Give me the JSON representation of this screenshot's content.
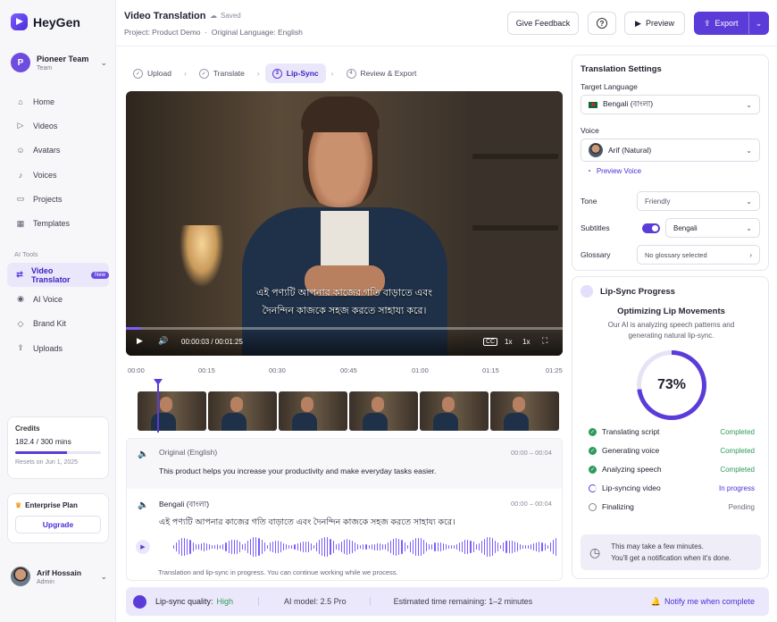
{
  "app": {
    "name": "HeyGen"
  },
  "sidebar": {
    "team": {
      "initial": "P",
      "name": "Pioneer Team",
      "role": "Team"
    },
    "nav": [
      {
        "label": "Home",
        "icon": "home-icon"
      },
      {
        "label": "Videos",
        "icon": "video-icon"
      },
      {
        "label": "Avatars",
        "icon": "avatar-icon"
      },
      {
        "label": "Voices",
        "icon": "voice-icon"
      },
      {
        "label": "Projects",
        "icon": "folder-icon"
      },
      {
        "label": "Templates",
        "icon": "template-icon"
      }
    ],
    "ai_tools_label": "AI Tools",
    "ai_nav": [
      {
        "label": "Video Translator",
        "icon": "translate-icon",
        "badge": "New",
        "active": true
      },
      {
        "label": "AI Voice",
        "icon": "mic-icon"
      },
      {
        "label": "Brand Kit",
        "icon": "brand-icon"
      },
      {
        "label": "Uploads",
        "icon": "upload-icon"
      }
    ],
    "credits": {
      "title": "Credits",
      "value": "182.4 / 300 mins",
      "fraction": 0.608,
      "reset": "Resets on Jun 1, 2025"
    },
    "plan": {
      "title": "Enterprise Plan",
      "button": "Upgrade"
    },
    "user": {
      "name": "Arif Hossain",
      "role": "Admin"
    }
  },
  "header": {
    "title": "Video Translation",
    "saved": "Saved",
    "project": "Project: Product Demo",
    "original_language": "Original Language: English",
    "feedback": "Give Feedback",
    "help": "?",
    "preview": "Preview",
    "export": "Export"
  },
  "steps": [
    {
      "label": "Upload",
      "num": "✓"
    },
    {
      "label": "Translate",
      "num": "✓"
    },
    {
      "label": "Lip-Sync",
      "num": "3"
    },
    {
      "label": "Review & Export",
      "num": "4"
    }
  ],
  "video": {
    "subtitle_line1": "এই পণ্যটি আপনার কাজের গতি বাড়াতে এবং",
    "subtitle_line2": "দৈনন্দিন কাজকে সহজ করতে সাহায্য করে।",
    "time": "00:00:03 / 00:01:25",
    "progress": 0.035,
    "cc": "CC",
    "speed": "1x",
    "zoom": "1x"
  },
  "timeline": {
    "ticks": [
      "00:00",
      "00:15",
      "00:30",
      "00:45",
      "01:00",
      "01:15",
      "01:25"
    ]
  },
  "tracks": {
    "original": {
      "label": "Original (English)",
      "time": "00:00 – 00:04",
      "text": "This product helps you increase your productivity and make everyday tasks easier."
    },
    "translated": {
      "label": "Bengali (বাংলা)",
      "time": "00:00 – 00:04",
      "text": "এই পণ্যটি আপনার কাজের গতি বাড়াতে এবং দৈনন্দিন কাজকে সহজ করতে সাহায্য করে।"
    },
    "note": "Translation and lip-sync in progress. You can continue working while we process."
  },
  "settings": {
    "title": "Translation Settings",
    "target_label": "Target Language",
    "target_value": "Bengali (বাংলা)",
    "voice_label": "Voice",
    "voice_value": "Arif (Natural)",
    "preview_voice": "Preview Voice",
    "tone_label": "Tone",
    "tone_value": "Friendly",
    "subtitles_label": "Subtitles",
    "subtitles_value": "Bengali",
    "glossary_label": "Glossary",
    "glossary_value": "No glossary selected"
  },
  "lipsync": {
    "title": "Lip-Sync Progress",
    "subtitle": "Optimizing Lip Movements",
    "desc_line1": "Our AI is analyzing speech patterns and",
    "desc_line2": "generating natural lip-sync.",
    "percent_label": "73%",
    "percent": 73,
    "steps": [
      {
        "label": "Translating script",
        "status": "Completed"
      },
      {
        "label": "Generating voice",
        "status": "Completed"
      },
      {
        "label": "Analyzing speech",
        "status": "Completed"
      },
      {
        "label": "Lip-syncing video",
        "status": "In progress"
      },
      {
        "label": "Finalizing",
        "status": "Pending"
      }
    ],
    "info_line1": "This may take a few minutes.",
    "info_line2": "You'll get a notification when it's done."
  },
  "status_bar": {
    "quality_label": "Lip-sync quality:",
    "quality_value": "High",
    "model": "AI model: 2.5 Pro",
    "eta": "Estimated time remaining: 1–2 minutes",
    "notify": "Notify me when complete"
  },
  "colors": {
    "accent": "#5b3cd8",
    "completed": "#2e9a5b",
    "in_progress": "#4a2fd6"
  }
}
